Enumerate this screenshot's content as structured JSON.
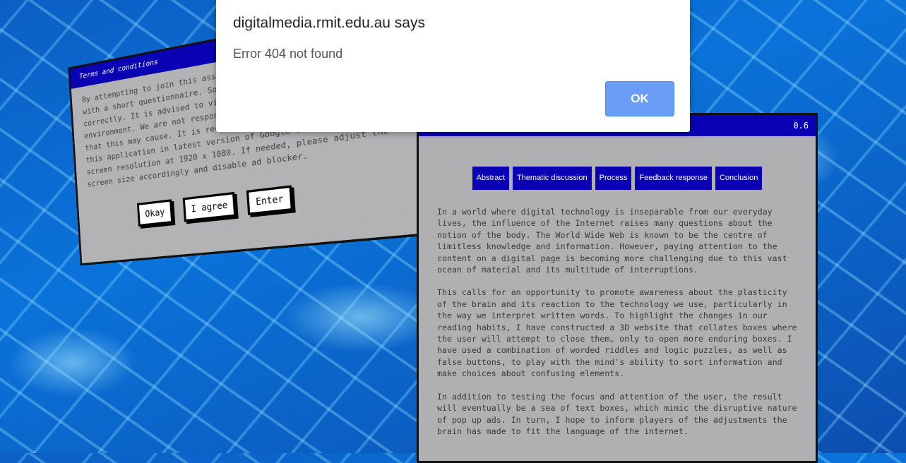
{
  "terms": {
    "title": "Terms and conditions",
    "body": "By attempting to join this association, you will be presented with a short questionnaire. Some elements may not display correctly. It is advised to view this website in a stable environment. We are not responsible for any stress or damages that this may cause. It is recommended to open the contents of this application in latest version of Google Chrome with a screen resolution at 1920 x 1080. If needed, please adjust the screen size accordingly and disable ad blocker.",
    "buttons": [
      "Okay",
      "I agree",
      "Enter"
    ]
  },
  "main": {
    "title_value": "0.6",
    "nav": [
      "Abstract",
      "Thematic discussion",
      "Process",
      "Feedback response",
      "Conclusion"
    ],
    "paragraphs": [
      "In a world where digital technology is inseparable from our everyday lives, the influence of the Internet raises many questions about the notion of the body. The World Wide Web is known to be the centre of limitless knowledge and information. However, paying attention to the content on a digital page is becoming more challenging due to this vast ocean of material and its multitude of interruptions.",
      "This calls for an opportunity to promote awareness about the plasticity of the brain and its reaction to the technology we use, particularly in the way we interpret written words. To highlight the changes in our reading habits, I have constructed a 3D website that collates boxes where the user will attempt to close them, only to open more enduring boxes. I have used a combination of worded riddles and logic puzzles, as well as false buttons, to play with the mind's ability to sort information and make choices about confusing elements.",
      "In addition to testing the focus and attention of the user, the result will eventually be a sea of text boxes, which mimic the disruptive nature of pop up ads. In turn, I hope to inform players of the adjustments the brain has made to fit the language of the internet."
    ]
  },
  "alert": {
    "title": "digitalmedia.rmit.edu.au says",
    "message": "Error 404 not found",
    "ok_label": "OK"
  }
}
